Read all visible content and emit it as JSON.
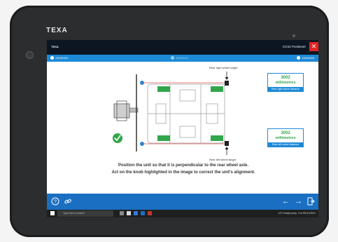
{
  "device": {
    "bezel_logo": "TEXA"
  },
  "app": {
    "brand": "TEXA",
    "window_title": "CCS2 Positioner",
    "close_icon": "close-icon"
  },
  "steps": [
    {
      "label": "13040184"
    },
    {
      "label": "13045193"
    },
    {
      "label": "13040368"
    }
  ],
  "diagram": {
    "rear_right_target_label": "Rear right wheel target",
    "rear_left_target_label": "Rear left wheel target"
  },
  "panels": {
    "right": {
      "value": "3002",
      "unit": "millimetres",
      "caption": "Rear right wheel distance",
      "color": "#31a64a"
    },
    "left": {
      "value": "3002",
      "unit": "millimetres",
      "caption": "Rear left wheel distance",
      "color": "#31a64a"
    }
  },
  "instructions": {
    "line1": "Position the unit so that it is perpendicular to the rear wheel axle.",
    "line2": "Act on the knob highlighted in the image to correct the unit's alignment."
  },
  "bottombar": {
    "help_icon": "help-icon",
    "link_icon": "link-icon",
    "back_icon": "arrow-left-icon",
    "next_icon": "arrow-right-icon",
    "exit_icon": "exit-icon"
  },
  "taskbar": {
    "search_placeholder": "Type here to search",
    "weather": "14°C Mostly sunny",
    "time": "2:14 PM",
    "date": "4/1/2021"
  },
  "colors": {
    "accent": "#1d8ad8",
    "ok": "#31a64a",
    "close": "#e12424",
    "laser": "#e05050"
  }
}
